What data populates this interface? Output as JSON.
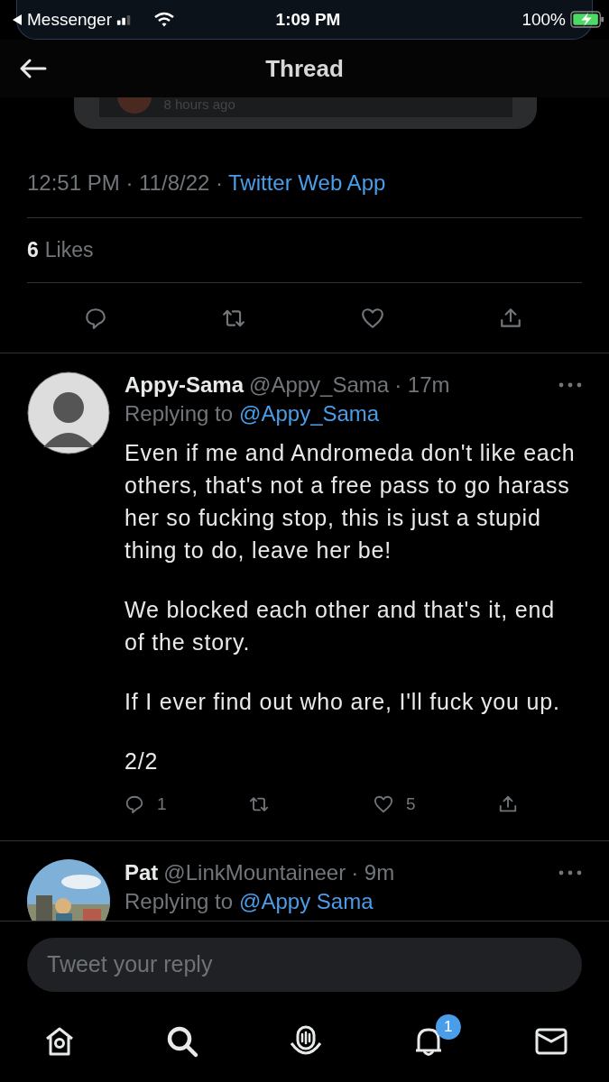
{
  "status_bar": {
    "back_app": "Messenger",
    "time": "1:09 PM",
    "battery": "100%"
  },
  "header": {
    "title": "Thread"
  },
  "quoted_card": {
    "time": "8 hours ago"
  },
  "meta": {
    "timestamp": "12:51 PM · 11/8/22 ·",
    "source": "Twitter Web App"
  },
  "likes": {
    "count": "6",
    "label": "Likes"
  },
  "replies": [
    {
      "name": "Appy-Sama",
      "handle": "@Appy_Sama",
      "time": "· 17m",
      "avatar": {
        "kind": "silhouette"
      },
      "replying_label": "Replying to",
      "replying_handle": "@Appy_Sama",
      "paragraphs": [
        "Even if me and Andromeda don't like each others, that's not a free pass to go harass her so fucking stop, this is just a stupid thing to do, leave her be!",
        "We blocked each other and that's it, end of the story.",
        "If I ever find out who are, I'll fuck you up.",
        "2/2"
      ],
      "reply_count": "1",
      "like_count": "5"
    },
    {
      "name": "Pat",
      "handle": "@LinkMountaineer",
      "time": "· 9m",
      "replying_label": "Replying to",
      "replying_handle": "@Appy Sama"
    }
  ],
  "compose": {
    "placeholder": "Tweet your reply"
  },
  "tabs": [
    {
      "kind": "home"
    },
    {
      "kind": "search"
    },
    {
      "kind": "spaces"
    },
    {
      "kind": "notifications",
      "badge": "1"
    },
    {
      "kind": "messages"
    }
  ]
}
